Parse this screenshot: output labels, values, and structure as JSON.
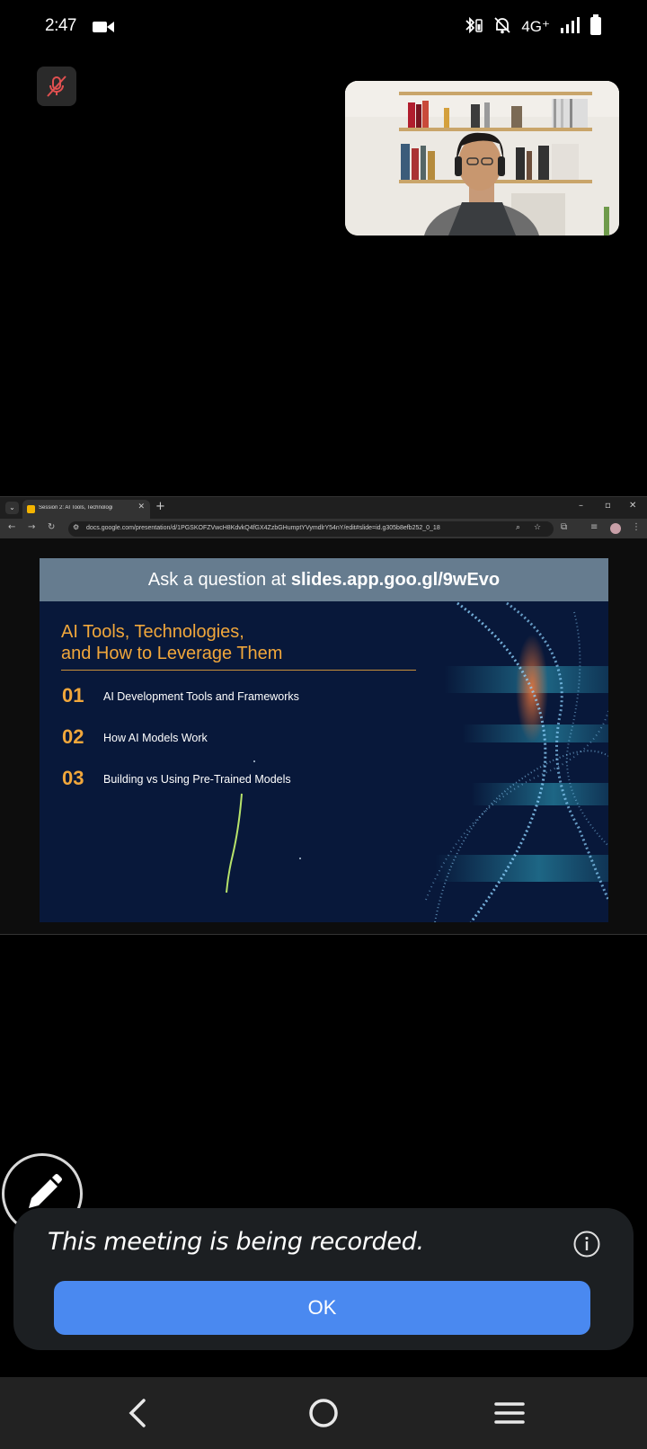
{
  "status_bar": {
    "time": "2:47",
    "network": "4G⁺"
  },
  "shared_screen": {
    "tab_title": "Session 2: AI Tools, Technologi",
    "url": "docs.google.com/presentation/d/1PGSKOFZVwcH8KdvkQ4fGX4ZzbGHumptYVymdlrY54nY/edit#slide=id.g305b8efb252_0_18",
    "slide": {
      "banner_prefix": "Ask a question at ",
      "banner_link": "slides.app.goo.gl/9wEvo",
      "title_line1": "AI Tools, Technologies,",
      "title_line2": "and How to Leverage Them",
      "agenda": [
        {
          "num": "01",
          "text": "AI Development Tools and Frameworks"
        },
        {
          "num": "02",
          "text": "How AI Models Work"
        },
        {
          "num": "03",
          "text": "Building vs Using Pre-Trained Models"
        }
      ]
    }
  },
  "recording_dialog": {
    "message": "This meeting is being recorded.",
    "ok_label": "OK"
  },
  "colors": {
    "accent": "#4a89f0",
    "slide_orange": "#f1a73b",
    "slide_bg": "#08183a",
    "muted_red": "#e05050"
  }
}
